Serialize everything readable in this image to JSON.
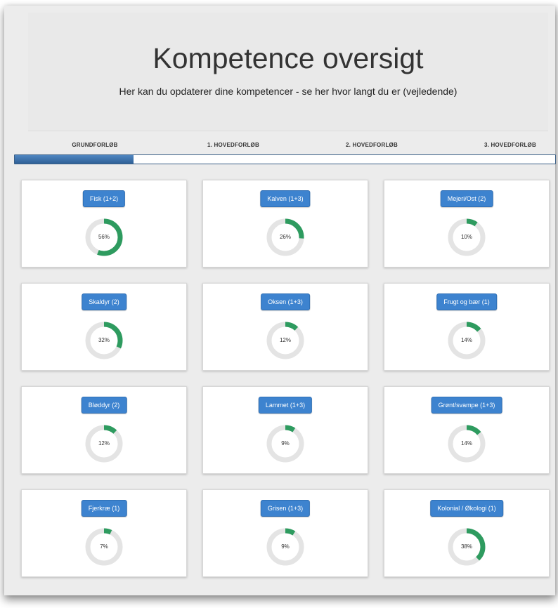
{
  "header": {
    "title": "Kompetence oversigt",
    "subtitle": "Her kan du opdaterer dine kompetencer - se her hvor langt du er (vejledende)"
  },
  "steps": {
    "labels": [
      "GRUNDFORLØB",
      "1. HOVEDFORLØB",
      "2. HOVEDFORLØB",
      "3. HOVEDFORLØB"
    ],
    "progress_fraction": 0.22,
    "active_color": "#2f6097"
  },
  "colors": {
    "accent": "#3d83cf",
    "donut_fill": "#2e9b5f",
    "donut_track": "#e4e4e4"
  },
  "cards": [
    {
      "label": "Fisk (1+2)",
      "percent": 56,
      "percent_text": "56%"
    },
    {
      "label": "Kalven (1+3)",
      "percent": 26,
      "percent_text": "26%"
    },
    {
      "label": "Mejeri/Ost (2)",
      "percent": 10,
      "percent_text": "10%"
    },
    {
      "label": "Skaldyr (2)",
      "percent": 32,
      "percent_text": "32%"
    },
    {
      "label": "Oksen (1+3)",
      "percent": 12,
      "percent_text": "12%"
    },
    {
      "label": "Frugt og bær (1)",
      "percent": 14,
      "percent_text": "14%"
    },
    {
      "label": "Bløddyr (2)",
      "percent": 12,
      "percent_text": "12%"
    },
    {
      "label": "Lammet (1+3)",
      "percent": 9,
      "percent_text": "9%"
    },
    {
      "label": "Grønt/svampe (1+3)",
      "percent": 14,
      "percent_text": "14%"
    },
    {
      "label": "Fjerkræ (1)",
      "percent": 7,
      "percent_text": "7%"
    },
    {
      "label": "Grisen (1+3)",
      "percent": 9,
      "percent_text": "9%"
    },
    {
      "label": "Kolonial / Økologi (1)",
      "percent": 38,
      "percent_text": "38%"
    }
  ]
}
